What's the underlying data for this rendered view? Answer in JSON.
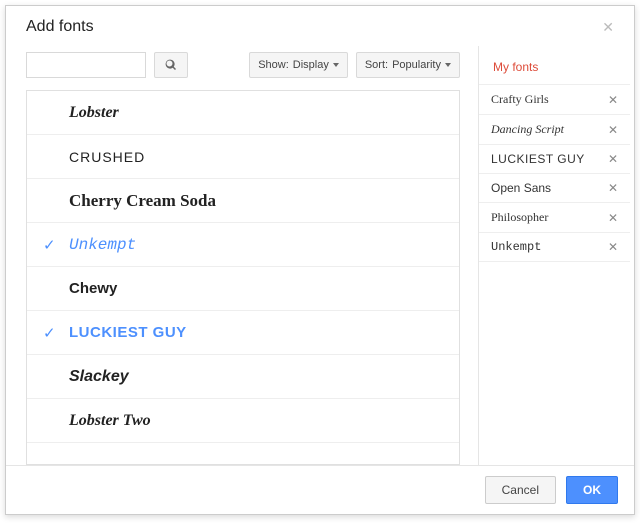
{
  "dialog": {
    "title": "Add fonts"
  },
  "toolbar": {
    "show": {
      "prefix": "Show:",
      "value": "Display"
    },
    "sort": {
      "prefix": "Sort:",
      "value": "Popularity"
    }
  },
  "fonts": [
    {
      "name": "Lobster",
      "style": "style-lobster",
      "selected": false
    },
    {
      "name": "Crushed",
      "style": "style-crushed",
      "selected": false
    },
    {
      "name": "Cherry Cream Soda",
      "style": "style-cherry",
      "selected": false
    },
    {
      "name": "Unkempt",
      "style": "style-unkempt",
      "selected": true
    },
    {
      "name": "Chewy",
      "style": "style-chewy",
      "selected": false
    },
    {
      "name": "Luckiest Guy",
      "style": "style-luckiest",
      "selected": true
    },
    {
      "name": "Slackey",
      "style": "style-slackey",
      "selected": false
    },
    {
      "name": "Lobster Two",
      "style": "style-lobster-two",
      "selected": false
    }
  ],
  "myfonts": {
    "title": "My fonts",
    "items": [
      {
        "name": "Crafty Girls",
        "style": "style-crafty"
      },
      {
        "name": "Dancing Script",
        "style": "style-dancing"
      },
      {
        "name": "Luckiest Guy",
        "style": "style-luckiest-side"
      },
      {
        "name": "Open Sans",
        "style": "style-opensans"
      },
      {
        "name": "Philosopher",
        "style": "style-philosopher"
      },
      {
        "name": "Unkempt",
        "style": "style-unkempt-side"
      }
    ]
  },
  "footer": {
    "cancel": "Cancel",
    "ok": "OK"
  }
}
